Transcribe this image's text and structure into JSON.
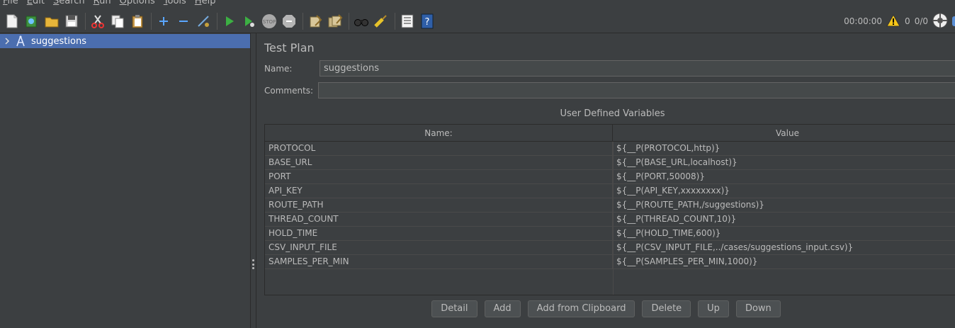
{
  "menu": [
    "File",
    "Edit",
    "Search",
    "Run",
    "Options",
    "Tools",
    "Help"
  ],
  "toolbar": {
    "icons": [
      "new-icon",
      "templates-icon",
      "open-icon",
      "save-icon",
      "cut-icon",
      "copy-icon",
      "paste-icon",
      "expand-icon",
      "collapse-icon",
      "toggle-icon",
      "start-icon",
      "start-no-pause-icon",
      "stop-icon",
      "shutdown-icon",
      "clear-icon",
      "clear-all-icon",
      "search-icon",
      "reset-search-icon",
      "function-helper-icon",
      "help-icon"
    ],
    "timer": "00:00:00",
    "warnings": "0",
    "threads": "0/0"
  },
  "tree": {
    "root_label": "suggestions"
  },
  "panel": {
    "title": "Test Plan",
    "name_label": "Name:",
    "name_value": "suggestions",
    "comments_label": "Comments:",
    "comments_value": "",
    "section_title": "User Defined Variables"
  },
  "table": {
    "headers": [
      "Name:",
      "Value"
    ],
    "rows": [
      {
        "name": "PROTOCOL",
        "value": "${__P(PROTOCOL,http)}"
      },
      {
        "name": "BASE_URL",
        "value": "${__P(BASE_URL,localhost)}"
      },
      {
        "name": "PORT",
        "value": "${__P(PORT,50008)}"
      },
      {
        "name": "API_KEY",
        "value": "${__P(API_KEY,xxxxxxxx)}"
      },
      {
        "name": "ROUTE_PATH",
        "value": "${__P(ROUTE_PATH,/suggestions)}"
      },
      {
        "name": "THREAD_COUNT",
        "value": "${__P(THREAD_COUNT,10)}"
      },
      {
        "name": "HOLD_TIME",
        "value": "${__P(HOLD_TIME,600)}"
      },
      {
        "name": "CSV_INPUT_FILE",
        "value": "${__P(CSV_INPUT_FILE,../cases/suggestions_input.csv)}"
      },
      {
        "name": "SAMPLES_PER_MIN",
        "value": "${__P(SAMPLES_PER_MIN,1000)}"
      }
    ]
  },
  "buttons": {
    "detail": "Detail",
    "add": "Add",
    "add_clipboard": "Add from Clipboard",
    "delete": "Delete",
    "up": "Up",
    "down": "Down"
  }
}
